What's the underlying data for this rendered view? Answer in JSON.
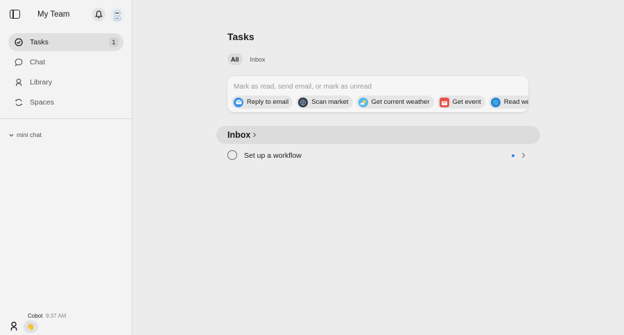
{
  "sidebar": {
    "team_name": "My Team",
    "nav": [
      {
        "label": "Tasks",
        "badge": "1"
      },
      {
        "label": "Chat"
      },
      {
        "label": "Library"
      },
      {
        "label": "Spaces"
      }
    ],
    "mini_chat_label": "mini chat",
    "chat_preview": {
      "sender": "Cobot",
      "time": "9:37 AM",
      "message": "👋"
    }
  },
  "main": {
    "title": "Tasks",
    "tabs": [
      {
        "label": "All",
        "active": true
      },
      {
        "label": "Inbox",
        "active": false
      }
    ],
    "prompt": {
      "placeholder": "Mark as read, send email, or mark as unread",
      "value": "",
      "chips": [
        {
          "label": "Reply to email",
          "icon": "mail-icon",
          "color": "#3b8fe8"
        },
        {
          "label": "Scan market",
          "icon": "globe-dark-icon",
          "color": "#2b3440"
        },
        {
          "label": "Get current weather",
          "icon": "weather-icon",
          "color": "#55b8ef"
        },
        {
          "label": "Get event",
          "icon": "calendar-icon",
          "color": "#e5534b"
        },
        {
          "label": "Read web page",
          "icon": "globe-icon",
          "color": "#2a86d6"
        }
      ]
    },
    "section": {
      "title": "Inbox"
    },
    "tasks": [
      {
        "label": "Set up a workflow",
        "unread": true
      }
    ]
  },
  "colors": {
    "accent": "#2f80ed",
    "active_nav_bg": "#e0e0e0"
  }
}
